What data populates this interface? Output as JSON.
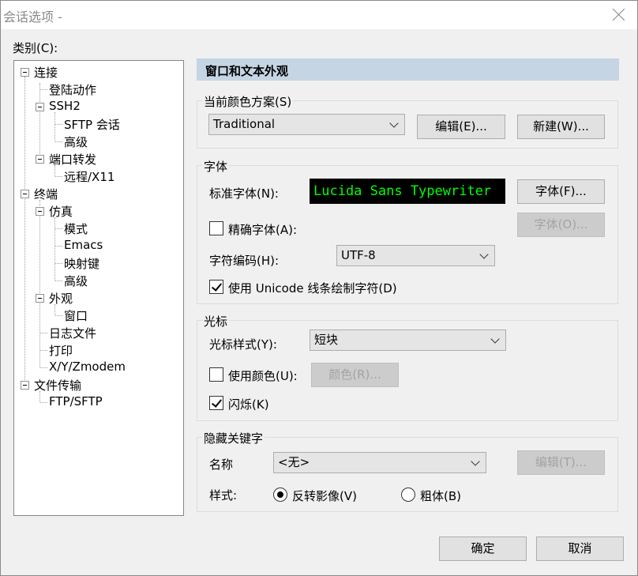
{
  "window": {
    "title": "会话选项 -"
  },
  "category_label": "类别(C):",
  "tree": {
    "connection": "连接",
    "login_actions": "登陆动作",
    "ssh2": "SSH2",
    "sftp_session": "SFTP 会话",
    "advanced1": "高级",
    "port_forwarding": "端口转发",
    "remote_x11": "远程/X11",
    "terminal": "终端",
    "emulation": "仿真",
    "modes": "模式",
    "emacs": "Emacs",
    "keymap": "映射键",
    "advanced2": "高级",
    "appearance": "外观",
    "window": "窗口",
    "log_file": "日志文件",
    "printing": "打印",
    "xyzmodem": "X/Y/Zmodem",
    "file_transfer": "文件传输",
    "ftp_sftp": "FTP/SFTP"
  },
  "header": "窗口和文本外观",
  "color_scheme": {
    "group": "当前颜色方案(S)",
    "value": "Traditional",
    "edit": "编辑(E)...",
    "new": "新建(W)..."
  },
  "font": {
    "group": "字体",
    "normal_label": "标准字体(N):",
    "sample": "Lucida Sans Typewriter",
    "font_btn": "字体(F)...",
    "precise_label": "精确字体(A):",
    "font_o_btn": "字体(O)...",
    "encoding_label": "字符编码(H):",
    "encoding_value": "UTF-8",
    "unicode_label": "使用 Unicode 线条绘制字符(D)"
  },
  "cursor": {
    "group": "光标",
    "style_label": "光标样式(Y):",
    "style_value": "短块",
    "use_color_label": "使用颜色(U):",
    "color_btn": "颜色(R)...",
    "blink_label": "闪烁(K)"
  },
  "keywords": {
    "group": "隐藏关键字",
    "name_label": "名称",
    "name_value": "<无>",
    "edit_btn": "编辑(T)...",
    "style_label": "样式:",
    "reverse_label": "反转影像(V)",
    "bold_label": "粗体(B)"
  },
  "footer": {
    "ok": "确定",
    "cancel": "取消"
  }
}
